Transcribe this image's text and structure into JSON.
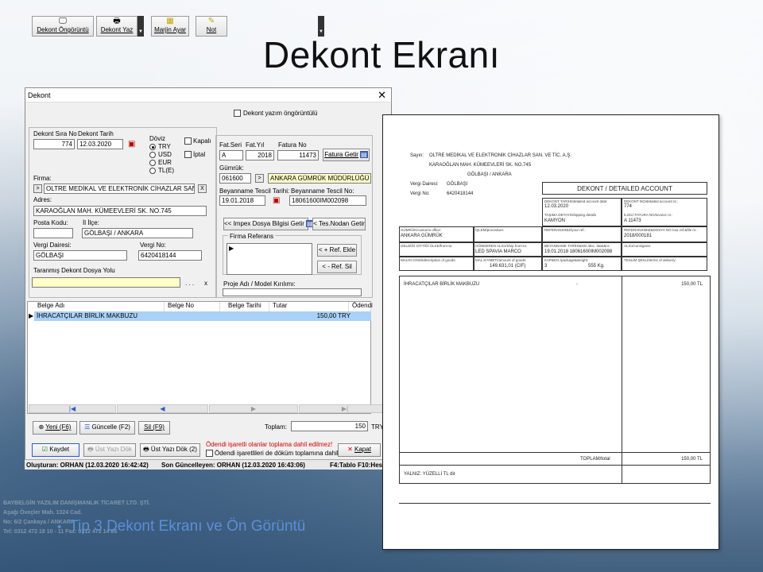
{
  "slide": {
    "title": "Dekont Ekranı",
    "bullet": "Tip 3 Dekont Ekranı ve Ön Görüntü",
    "company_lines": [
      "BAYBELGİN YAZILIM DANIŞMANLIK TİCARET LTD. ŞTİ.",
      "Aşağı Öveçler Mah. 1324 Cad.",
      "No: 6/2 Çankaya / ANKARA",
      "Tel: 0312 472 18 10 - 11 Fax: 0312 472 14 88"
    ]
  },
  "dialog": {
    "title": "Dekont",
    "toolbar": {
      "preview": "Dekont Öngörüntü",
      "print": "Dekont Yaz",
      "margin": "Marjin Ayar",
      "note": "Not",
      "preview_check": "Dekont yazım öngörüntülü"
    },
    "labels": {
      "sira_no": "Dekont Sıra No",
      "tarih": "Dekont Tarih",
      "doviz": "Döviz",
      "kapali": "Kapalı",
      "iptal": "İptal",
      "firma": "Firma:",
      "adres": "Adres:",
      "posta": "Posta Kodu:",
      "ilce": "İl İlçe:",
      "vergi_dairesi": "Vergi Dairesi:",
      "vergi_no": "Vergi No:",
      "taranmis": "Taranmış Dekont Dosya Yolu",
      "fat_seri": "Fat.Seri",
      "fat_yil": "Fat.Yıl",
      "fatura_no": "Fatura No",
      "gumruk": "Gümrük:",
      "beyan_tarih": "Beyanname Tescil Tarihi:",
      "beyan_no": "Beyanname Tescil No:",
      "firma_ref": "Firma Referans",
      "proje": "Proje Adı / Model Kırılımı:"
    },
    "doviz_options": [
      "TRY",
      "USD",
      "EUR",
      "TL(E)"
    ],
    "values": {
      "sira_no": "774",
      "tarih": "12.03.2020",
      "firma": "OLTRE MEDİKAL VE ELEKTRONİK CİHAZLAR SAN.",
      "adres": "KARAOĞLAN MAH. KÜMEEVLERİ SK. NO.745",
      "posta": "",
      "ilce": "GÖLBAŞI / ANKARA",
      "vergi_dairesi": "GÖLBAŞI",
      "vergi_no": "6420418144",
      "taranmis": "",
      "fat_seri": "A",
      "fat_yil": "2018",
      "fatura_no": "11473",
      "gumruk_kod": "061600",
      "gumruk_ad": "ANKARA GÜMRÜK MÜDÜRLÜĞÜ",
      "beyan_tarih": "19.01.2018",
      "beyan_no": "18061600IM002098"
    },
    "buttons": {
      "fatura_getir": "Fatura Getir",
      "impex": "<< Impex Dosya Bilgisi Getir",
      "tes_nodan": "< Tes.Nodan Getir",
      "ref_ekle": "< + Ref. Ekle",
      "ref_sil": "< - Ref. Sil",
      "yeni": "Yeni (F6)",
      "guncelle": "Güncelle (F2)",
      "sil": "Sil (F9)",
      "kaydet": "Kaydet",
      "ust_yazi_dok": "Üst Yazı Dök",
      "ust_yazi_dok2": "Üst Yazı Dök (2)",
      "kapat": "Kapat",
      "dots": ". . .",
      "x": "x"
    },
    "grid": {
      "columns": [
        "Belge Adı",
        "Belge No",
        "Belge Tarihi",
        "Tutar",
        "Ödendi"
      ],
      "rows": [
        {
          "belge_adi": "İHRACATÇILAR BİRLİK MAKBUZU",
          "belge_no": "",
          "belge_tarihi": "",
          "tutar": "150,00 TRY"
        }
      ]
    },
    "toplam_label": "Toplam:",
    "toplam_value": "150",
    "toplam_unit": "TRY",
    "warn": "Ödendi işaretli olanlar toplama dahil edilmez!",
    "odendi_check": "Ödendi işaretlileri de döküm toplamına dahil et",
    "status": {
      "created": "Oluşturan: ORHAN (12.03.2020 16:42:42)",
      "updated": "Son Güncelleyen: ORHAN (12.03.2020 16:43:06)",
      "keys": "F4:Tablo F10:Hesap"
    }
  },
  "preview": {
    "sayin_label": "Sayın:",
    "sayin": "OLTRE MEDİKAL VE ELEKTRONİK CİHAZLAR SAN. VE TİC. A.Ş.",
    "addr1": "KARAOĞLAN MAH. KÜMEEVLERİ SK. NO.745",
    "addr2": "GÖLBAŞI / ANKARA",
    "vd_label": "Vergi Dairesi:",
    "vd": "GÖLBAŞI",
    "vn_label": "Vergi No:",
    "vn": "6420418144",
    "heading": "DEKONT / DETAILED ACCOUNT",
    "cells": {
      "date_l": "DEKONT TARİHİ/detailed account date:",
      "date": "12.03.2020",
      "no_l": "DEKONT NO/detailed account nr.:",
      "no": "774",
      "tasima_l": "TAŞIMA DETAYI/shipping details",
      "tasima": "KAMYON",
      "fatno_l": "İLGİLİ FATURA NO/invoice nr.:",
      "fatno": "A 11473",
      "gumruk_l": "GÜMRÜK/customs office:",
      "gumruk": "ANKARA GÜMRÜK",
      "islem_l": "İŞLEM/procedure:",
      "islem": "",
      "ref_l": "REFERANSINIZ/your ref.:",
      "ref": "",
      "bizimref_l": "REFERANSIMIZ&DOSYA NO./our ref.&file nr.:",
      "bizimref": "2018/000181",
      "ulke_l": "GELDİĞİ GİTTİĞİ ÜLKE/from-to:",
      "ulke": "",
      "gonderen_l": "GÖNDEREN ALICI/Ship from-to:",
      "gonderen": "LED SPAVIA MARCO",
      "beyan_l": "BEYANNAME TARİHİ&NO./dec. date&nr.:",
      "beyan": "19.01.2018  18061600IM002098",
      "alici_l": "ALICI/consignee:",
      "alici": "",
      "malcins_l": "MALIN CİNSİ/description of goods:",
      "malcins": "",
      "kiymet_l": "MAL KIYMETİ/amount of goods:",
      "kiymet": "149.631,01   (CIF)",
      "kap_l": "KAP&KG./package&weight:",
      "kap": "3",
      "kg": "555 Kg.",
      "teslim_l": "TESLİM ŞEKLİ/terms of delivery:",
      "teslim": ""
    },
    "item": "İHRACATÇILAR BİRLİK MAKBUZU",
    "item_dash": "-",
    "item_amount": "150,00 TL",
    "total_label": "TOPLAM/total",
    "total": "150,00 TL",
    "yalniz": "YALNIZ:  YÜZELLİ  TL  dir"
  }
}
